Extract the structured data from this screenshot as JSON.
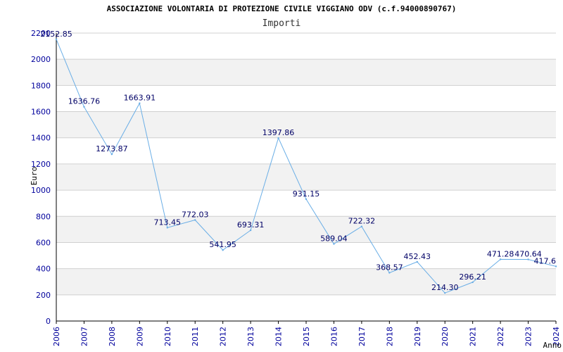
{
  "chart_data": {
    "type": "line",
    "title": "ASSOCIAZIONE VOLONTARIA DI PROTEZIONE CIVILE VIGGIANO ODV (c.f.94000890767)",
    "subtitle": "Importi",
    "xlabel": "Anno",
    "ylabel": "Euro",
    "ylim": [
      0,
      2200
    ],
    "yticks": [
      0,
      200,
      400,
      600,
      800,
      1000,
      1200,
      1400,
      1600,
      1800,
      2000,
      2200
    ],
    "grid": true,
    "x": [
      "2006",
      "2007",
      "2008",
      "2009",
      "2010",
      "2011",
      "2012",
      "2013",
      "2014",
      "2015",
      "2016",
      "2017",
      "2018",
      "2019",
      "2020",
      "2021",
      "2022",
      "2023",
      "2024"
    ],
    "series": [
      {
        "values": [
          2152.85,
          1636.76,
          1273.87,
          1663.91,
          713.45,
          772.03,
          541.95,
          693.31,
          1397.86,
          931.15,
          589.04,
          722.32,
          368.57,
          452.43,
          214.3,
          296.21,
          471.28,
          470.64,
          417.6
        ],
        "labels": [
          "2152.85",
          "1636.76",
          "1273.87",
          "1663.91",
          "713.45",
          "772.03",
          "541.95",
          "693.31",
          "1397.86",
          "931.15",
          "589.04",
          "722.32",
          "368.57",
          "452.43",
          "214.30",
          "296.21",
          "471.28",
          "470.64",
          "417.6"
        ]
      }
    ],
    "colors": {
      "line": "#6aaee6",
      "band": "#f2f2f2",
      "grid": "#d0d0d0",
      "axis": "#000000",
      "tick_text": "#00009c",
      "label_text": "#000066"
    }
  }
}
